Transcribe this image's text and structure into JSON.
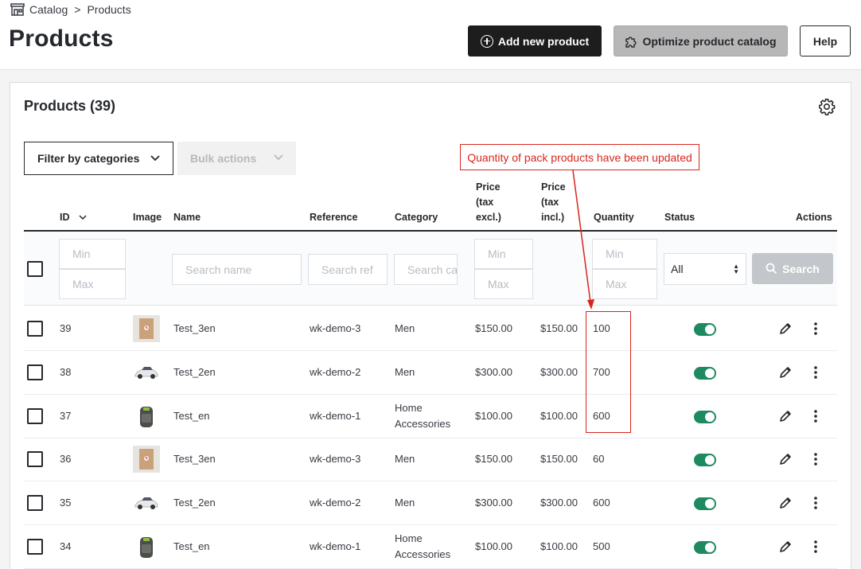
{
  "breadcrumb": {
    "parent": "Catalog",
    "separator": ">",
    "current": "Products"
  },
  "page_title": "Products",
  "header_buttons": {
    "add": "Add new product",
    "optimize": "Optimize product catalog",
    "help": "Help"
  },
  "card": {
    "title": "Products (39)",
    "filter_by_categories": "Filter by categories",
    "bulk_actions": "Bulk actions"
  },
  "columns": {
    "id": "ID",
    "image": "Image",
    "name": "Name",
    "reference": "Reference",
    "category": "Category",
    "price_excl": [
      "Price",
      "(tax",
      "excl.)"
    ],
    "price_incl": [
      "Price",
      "(tax",
      "incl.)"
    ],
    "quantity": "Quantity",
    "status": "Status",
    "actions": "Actions"
  },
  "filters": {
    "id_min": "Min",
    "id_max": "Max",
    "name_placeholder": "Search name",
    "reference_placeholder": "Search ref",
    "category_placeholder": "Search ca",
    "price_min": "Min",
    "price_max": "Max",
    "qty_min": "Min",
    "qty_max": "Max",
    "status_value": "All",
    "search_button": "Search"
  },
  "rows": [
    {
      "id": "39",
      "image": "notebook",
      "name": "Test_3en",
      "reference": "wk-demo-3",
      "category": [
        "Men"
      ],
      "price_excl": "$150.00",
      "price_incl": "$150.00",
      "quantity": "100",
      "status_enabled": true
    },
    {
      "id": "38",
      "image": "car",
      "name": "Test_2en",
      "reference": "wk-demo-2",
      "category": [
        "Men"
      ],
      "price_excl": "$300.00",
      "price_incl": "$300.00",
      "quantity": "700",
      "status_enabled": true
    },
    {
      "id": "37",
      "image": "backpack",
      "name": "Test_en",
      "reference": "wk-demo-1",
      "category": [
        "Home",
        "Accessories"
      ],
      "price_excl": "$100.00",
      "price_incl": "$100.00",
      "quantity": "600",
      "status_enabled": true
    },
    {
      "id": "36",
      "image": "notebook",
      "name": "Test_3en",
      "reference": "wk-demo-3",
      "category": [
        "Men"
      ],
      "price_excl": "$150.00",
      "price_incl": "$150.00",
      "quantity": "60",
      "status_enabled": true
    },
    {
      "id": "35",
      "image": "car",
      "name": "Test_2en",
      "reference": "wk-demo-2",
      "category": [
        "Men"
      ],
      "price_excl": "$300.00",
      "price_incl": "$300.00",
      "quantity": "600",
      "status_enabled": true
    },
    {
      "id": "34",
      "image": "backpack",
      "name": "Test_en",
      "reference": "wk-demo-1",
      "category": [
        "Home",
        "Accessories"
      ],
      "price_excl": "$100.00",
      "price_incl": "$100.00",
      "quantity": "500",
      "status_enabled": true
    }
  ],
  "annotation": {
    "text": "Quantity of pack products have been updated",
    "color": "#d9261c"
  },
  "colors": {
    "primary_dark": "#1d1d1d",
    "toggle_on": "#1d8a5f",
    "disabled_gray": "#b7b7b7"
  }
}
